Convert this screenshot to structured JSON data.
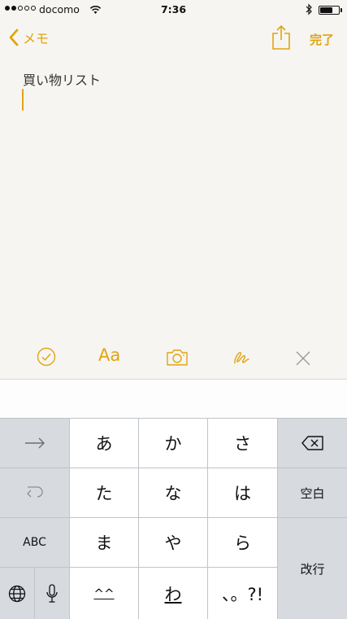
{
  "status_bar": {
    "carrier": "docomo",
    "time": "7:36"
  },
  "nav": {
    "back_label": "メモ",
    "done_label": "完了"
  },
  "note": {
    "title": "買い物リスト"
  },
  "toolbar": {
    "text_style_label": "Aa"
  },
  "keyboard": {
    "rows": [
      [
        "あ",
        "か",
        "さ"
      ],
      [
        "た",
        "な",
        "は"
      ],
      [
        "ま",
        "や",
        "ら"
      ],
      [
        "^^",
        "わ",
        "、。?!"
      ]
    ],
    "space_label": "空白",
    "abc_label": "ABC",
    "return_label": "改行"
  },
  "colors": {
    "accent": "#e2a40e",
    "toolbar_close": "#9a9a9a"
  }
}
